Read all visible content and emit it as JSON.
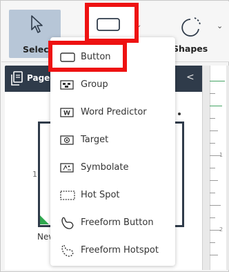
{
  "toolbar": {
    "select_label": "Select",
    "shapes_label": "Shapes"
  },
  "panel": {
    "pages_label": "Pages",
    "collapse_glyph": "<"
  },
  "canvas": {
    "page_number": "1",
    "page_name": "New Page"
  },
  "ruler": {
    "numbers": [
      "1",
      "2"
    ]
  },
  "dropdown": {
    "items": [
      {
        "label": "Button",
        "icon": "button-rect-icon"
      },
      {
        "label": "Group",
        "icon": "group-icon"
      },
      {
        "label": "Word Predictor",
        "icon": "word-predictor-icon"
      },
      {
        "label": "Target",
        "icon": "target-icon"
      },
      {
        "label": "Symbolate",
        "icon": "symbolate-icon"
      },
      {
        "label": "Hot Spot",
        "icon": "hot-spot-icon"
      },
      {
        "label": "Freeform Button",
        "icon": "freeform-button-icon"
      },
      {
        "label": "Freeform Hotspot",
        "icon": "freeform-hotspot-icon"
      }
    ]
  },
  "colors": {
    "highlight": "#ee1212",
    "dark_panel": "#2f3b4a",
    "select_bg": "#b7c6d7",
    "accent_green": "#2fa84f"
  }
}
